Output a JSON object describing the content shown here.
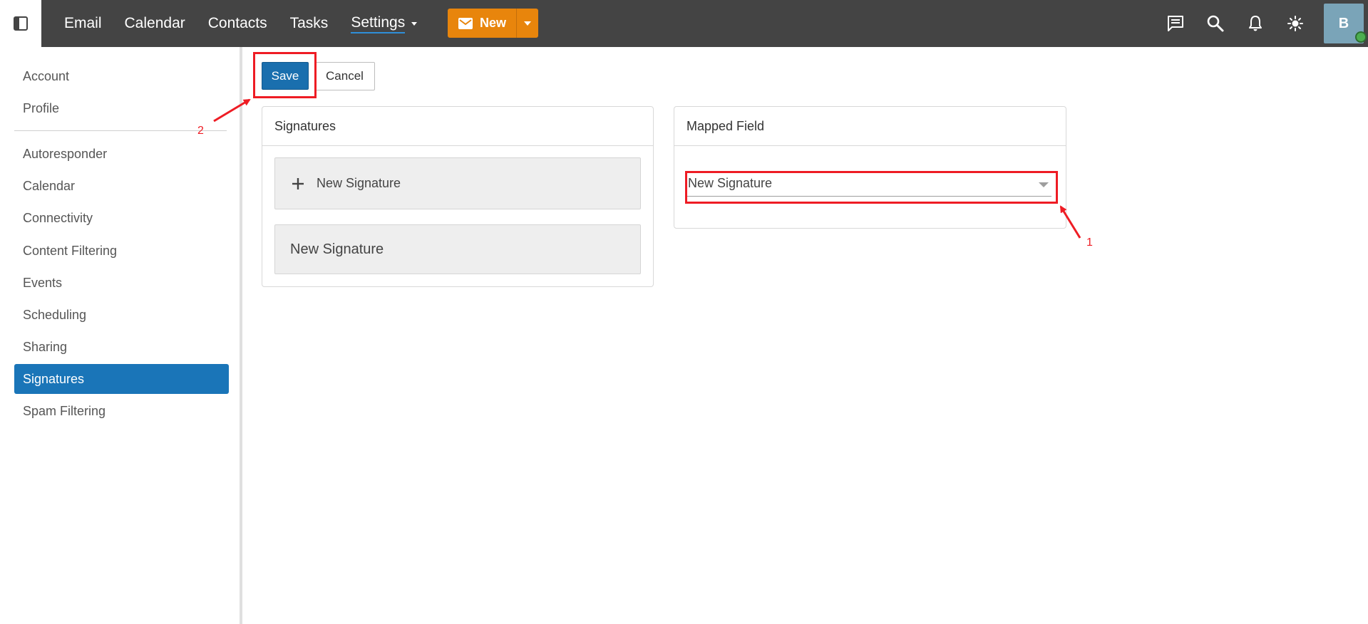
{
  "nav": {
    "items": [
      {
        "label": "Email",
        "active": false
      },
      {
        "label": "Calendar",
        "active": false
      },
      {
        "label": "Contacts",
        "active": false
      },
      {
        "label": "Tasks",
        "active": false
      },
      {
        "label": "Settings",
        "active": true
      }
    ],
    "new_label": "New"
  },
  "user": {
    "avatar_initial": "B",
    "presence": "online"
  },
  "sidebar": {
    "items": [
      {
        "label": "Account"
      },
      {
        "label": "Profile"
      },
      {
        "label": "Autoresponder"
      },
      {
        "label": "Calendar"
      },
      {
        "label": "Connectivity"
      },
      {
        "label": "Content Filtering"
      },
      {
        "label": "Events"
      },
      {
        "label": "Scheduling"
      },
      {
        "label": "Sharing"
      },
      {
        "label": "Signatures",
        "selected": true
      },
      {
        "label": "Spam Filtering"
      }
    ]
  },
  "actions": {
    "save_label": "Save",
    "cancel_label": "Cancel"
  },
  "signatures_panel": {
    "title": "Signatures",
    "new_signature_label": "New Signature",
    "items": [
      "New Signature"
    ]
  },
  "mapped_panel": {
    "title": "Mapped Field",
    "selected_value": "New Signature"
  },
  "annotations": {
    "step1": "1",
    "step2": "2"
  },
  "colors": {
    "topbar": "#444444",
    "accent_orange": "#e8850c",
    "accent_blue": "#1a75b8",
    "annotation_red": "#ee1c24"
  }
}
